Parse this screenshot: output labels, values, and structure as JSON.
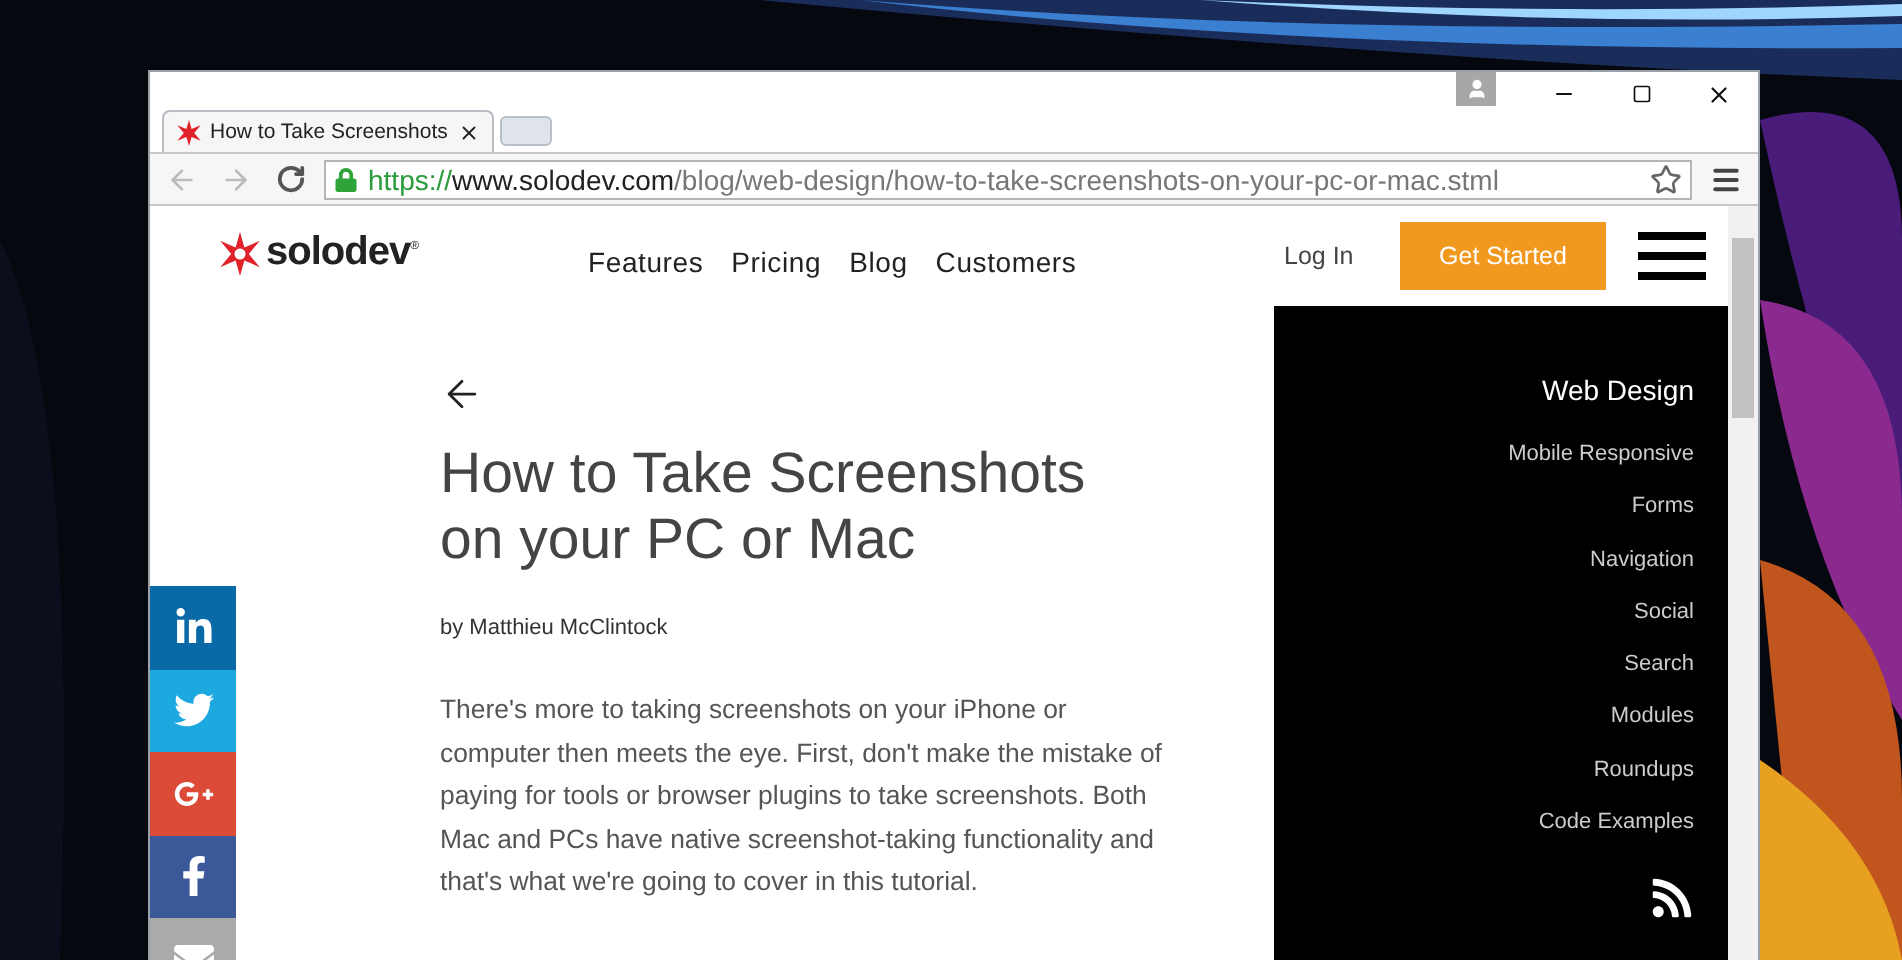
{
  "browser": {
    "tab": {
      "title": "How to Take Screenshots",
      "selected": true
    },
    "address": {
      "scheme": "https://",
      "host": "www.solodev.com",
      "path": "/blog/web-design/how-to-take-screenshots-on-your-pc-or-mac.stml",
      "secure": true
    }
  },
  "header": {
    "brand": "solodev",
    "brand_mark": "®",
    "nav": [
      "Features",
      "Pricing",
      "Blog",
      "Customers"
    ],
    "login": "Log In",
    "cta": "Get Started"
  },
  "article": {
    "title": "How to Take Screenshots on your PC or Mac",
    "byline": "by Matthieu McClintock",
    "body": "There's more to taking screenshots on your iPhone or computer then meets the eye. First, don't make the mistake of paying for tools or browser plugins to take screenshots. Both Mac and PCs have native screenshot-taking functionality and that's what we're going to cover in this tutorial."
  },
  "share": [
    {
      "kind": "linkedin",
      "color": "#0a6aa8"
    },
    {
      "kind": "twitter",
      "color": "#1da9e0"
    },
    {
      "kind": "googleplus",
      "color": "#dc4a38"
    },
    {
      "kind": "facebook",
      "color": "#3b5998"
    },
    {
      "kind": "email",
      "color": "#aaaaaa"
    }
  ],
  "sidebar": {
    "heading": "Web Design",
    "items": [
      "Mobile Responsive",
      "Forms",
      "Navigation",
      "Social",
      "Search",
      "Modules",
      "Roundups",
      "Code Examples"
    ]
  }
}
